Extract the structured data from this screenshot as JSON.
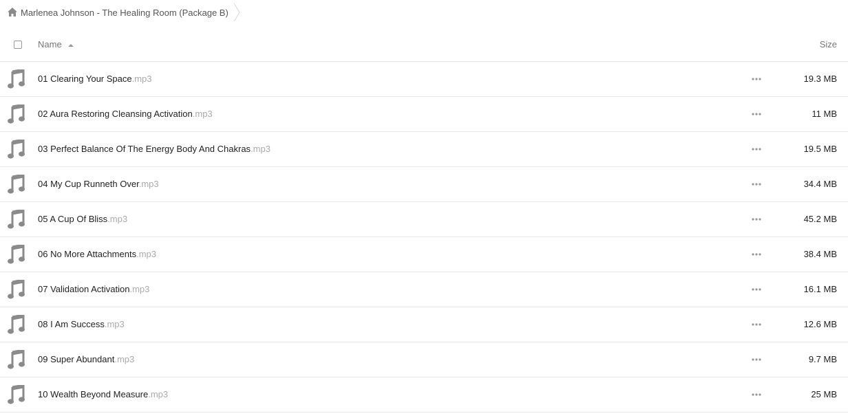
{
  "breadcrumb": {
    "icon": "home-icon",
    "label": "Marlenea Johnson - The Healing Room (Package B)"
  },
  "header": {
    "name_label": "Name",
    "size_label": "Size",
    "sort": "ascending"
  },
  "files": [
    {
      "name": "01 Clearing Your Space",
      "ext": ".mp3",
      "size": "19.3 MB"
    },
    {
      "name": "02 Aura Restoring Cleansing Activation",
      "ext": ".mp3",
      "size": "11 MB"
    },
    {
      "name": "03 Perfect Balance Of The Energy Body And Chakras",
      "ext": ".mp3",
      "size": "19.5 MB"
    },
    {
      "name": "04 My Cup Runneth Over",
      "ext": ".mp3",
      "size": "34.4 MB"
    },
    {
      "name": "05 A Cup Of Bliss",
      "ext": ".mp3",
      "size": "45.2 MB"
    },
    {
      "name": "06 No More Attachments",
      "ext": ".mp3",
      "size": "38.4 MB"
    },
    {
      "name": "07 Validation Activation",
      "ext": ".mp3",
      "size": "16.1 MB"
    },
    {
      "name": "08 I Am Success",
      "ext": ".mp3",
      "size": "12.6 MB"
    },
    {
      "name": "09 Super Abundant",
      "ext": ".mp3",
      "size": "9.7 MB"
    },
    {
      "name": "10 Wealth Beyond Measure",
      "ext": ".mp3",
      "size": "25 MB"
    }
  ],
  "colors": {
    "icon_gray": "#8a8a8a",
    "ext_gray": "#aaaaaa",
    "divider": "#e6e6e6"
  }
}
